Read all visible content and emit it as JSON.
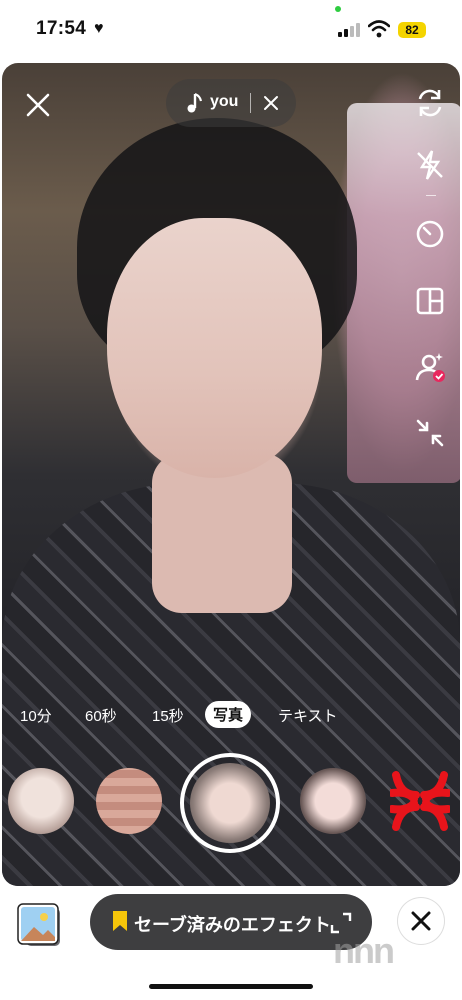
{
  "status_bar": {
    "time": "17:54",
    "battery": "82",
    "icons": [
      "heart-icon",
      "signal-icon",
      "wifi-icon",
      "battery-icon"
    ]
  },
  "camera": {
    "music": {
      "title": "you"
    },
    "right_tools": [
      "flip-camera-icon",
      "flash-off-icon",
      "timer-icon",
      "layout-icon",
      "duet-icon",
      "collapse-icon"
    ]
  },
  "modes": [
    {
      "label": "10分"
    },
    {
      "label": "60秒"
    },
    {
      "label": "15秒"
    },
    {
      "label": "写真",
      "active": true
    },
    {
      "label": "テキスト"
    }
  ],
  "effects": [
    "effect-1",
    "effect-2",
    "effect-selected",
    "effect-4",
    "effect-angry"
  ],
  "bottom": {
    "saved_effects_label": "セーブ済みのエフェクト",
    "watermark": "n\u0012n"
  },
  "colors": {
    "battery": "#f4d400",
    "pill_bg": "#3e3e40",
    "bookmark": "#f6c60a",
    "angry": "#e8141b",
    "duet_badge": "#e8285e"
  }
}
